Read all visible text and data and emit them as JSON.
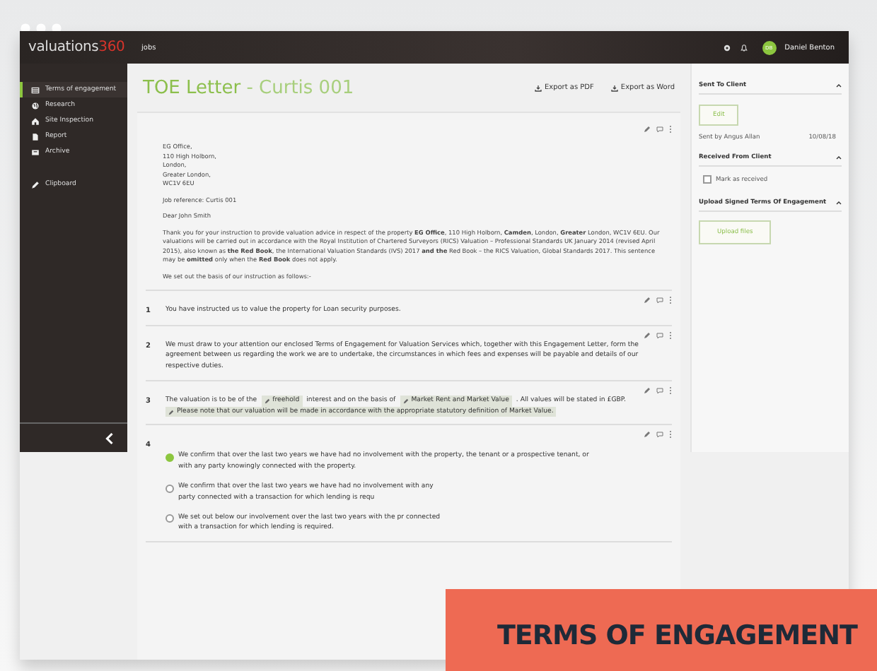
{
  "topbar": {
    "logo": {
      "word": "valuations",
      "number": "360"
    },
    "nav": "jobs",
    "user": {
      "initials": "DB",
      "name": "Daniel Benton"
    }
  },
  "sidebar": {
    "items": [
      {
        "label": "Terms of engagement",
        "kind": "table",
        "selected": true
      },
      {
        "label": "Research",
        "kind": "globe",
        "selected": false
      },
      {
        "label": "Site Inspection",
        "kind": "house",
        "selected": false
      },
      {
        "label": "Report",
        "kind": "document",
        "selected": false
      },
      {
        "label": "Archive",
        "kind": "box",
        "selected": false
      },
      {
        "label": "Clipboard",
        "kind": "pencil",
        "selected": false
      }
    ]
  },
  "document": {
    "title": "TOE Letter",
    "subtitle": " - Curtis 001",
    "exports": [
      "Export as PDF",
      "Export as Word"
    ],
    "letter": {
      "address": [
        "EG Office,",
        "110 High Holborn,",
        "London,",
        "Greater London,",
        "WC1V 6EU"
      ],
      "reference": "Job reference: Curtis 001",
      "greeting": "Dear John Smith",
      "body": "Thank you for your instruction to provide valuation advice in respect of the property **EG Office**, 110 High Holborn, **Camden**, London, **Greater** London, WC1V 6EU. Our valuations will be carried out in accordance with the Royal Institution of Chartered Surveyors (RICS) Valuation – Professional Standards UK January 2014 (revised April 2015), also known as **the Red Book**, the International Valuation Standards (IVS) 2017 **and the** Red Book – the RICS Valuation, Global Standards 2017. This sentence may be **omitted** only when the **Red Book** does not apply.",
      "closing": "We set out the basis of our instruction as follows:-"
    },
    "clauses": [
      {
        "number": "1",
        "kind": "text",
        "text": "You have instructed us to value the property for Loan security purposes."
      },
      {
        "number": "2",
        "kind": "text",
        "text": "We must draw to your attention our enclosed Terms of Engagement for Valuation Services which, together with this Engagement Letter, form the agreement between us regarding the work we are to undertake, the circumstances in which fees and expenses will be payable and details of our respective duties."
      },
      {
        "number": "3",
        "kind": "segments",
        "segments": [
          {
            "kind": "text",
            "text": "The valuation is to be of the"
          },
          {
            "kind": "tag",
            "text": "freehold"
          },
          {
            "kind": "text",
            "text": "interest and on the basis of"
          },
          {
            "kind": "tag",
            "text": "Market Rent and Market Value"
          },
          {
            "kind": "text",
            "text": ". All values will be stated in £GBP."
          },
          {
            "kind": "tag",
            "text": "Please note that our valuation will be made in accordance with the appropriate statutory definition of Market Value."
          }
        ]
      },
      {
        "number": "4",
        "kind": "options",
        "options": [
          {
            "text": "We confirm that over the last two years we have had no involvement with the property, the tenant or a prospective tenant, or with any party knowingly connected with the property.",
            "selected": true
          },
          {
            "text": "We confirm that over the last two years we have had no involvement with any party connected with a transaction for which lending is requ",
            "selected": false
          },
          {
            "text": "We set out below our involvement over the last two years with the pr connected with a transaction for which lending is required.",
            "selected": false
          }
        ]
      }
    ]
  },
  "panel": {
    "sections": [
      {
        "title": "Sent To Client",
        "expanded": true,
        "kind": "sent",
        "button": "Edit",
        "sent_by": "Sent by Angus Allan",
        "date": "10/08/18"
      },
      {
        "title": "Received From Client",
        "expanded": true,
        "kind": "checkbox",
        "label": "Mark as received",
        "checked": false
      },
      {
        "title": "Upload Signed Terms Of Engagement",
        "expanded": true,
        "kind": "upload",
        "button": "Upload files"
      }
    ]
  },
  "banner": "TERMS OF ENGAGEMENT"
}
